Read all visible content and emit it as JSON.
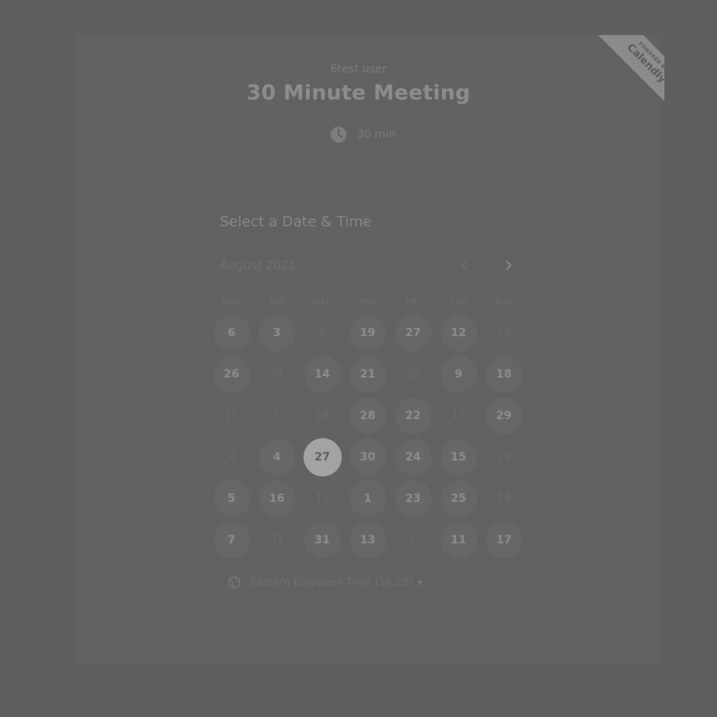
{
  "event": {
    "owner": "6test user",
    "title": "30 Minute Meeting",
    "duration": "30 min"
  },
  "badge": {
    "powered_by": "POWERED BY",
    "brand": "Calendly"
  },
  "calendar": {
    "section_title": "Select a Date & Time",
    "month": "August 2021",
    "weekdays": [
      "MON",
      "TUE",
      "WED",
      "THU",
      "FRI",
      "SAT",
      "SUN"
    ],
    "days": [
      {
        "label": "6",
        "available": true
      },
      {
        "label": "3",
        "available": true
      },
      {
        "label": "8",
        "available": false
      },
      {
        "label": "19",
        "available": true
      },
      {
        "label": "27",
        "available": true
      },
      {
        "label": "12",
        "available": true
      },
      {
        "label": "19",
        "available": false
      },
      {
        "label": "26",
        "available": true
      },
      {
        "label": "24",
        "available": false
      },
      {
        "label": "14",
        "available": true
      },
      {
        "label": "21",
        "available": true
      },
      {
        "label": "22",
        "available": false
      },
      {
        "label": "9",
        "available": true
      },
      {
        "label": "18",
        "available": true
      },
      {
        "label": "15",
        "available": false
      },
      {
        "label": "1",
        "available": false
      },
      {
        "label": "18",
        "available": false
      },
      {
        "label": "28",
        "available": true
      },
      {
        "label": "22",
        "available": true
      },
      {
        "label": "13",
        "available": false
      },
      {
        "label": "29",
        "available": true
      },
      {
        "label": "8",
        "available": false
      },
      {
        "label": "4",
        "available": true
      },
      {
        "label": "27",
        "available": true,
        "selected": true
      },
      {
        "label": "30",
        "available": true
      },
      {
        "label": "24",
        "available": true
      },
      {
        "label": "15",
        "available": true
      },
      {
        "label": "29",
        "available": false
      },
      {
        "label": "5",
        "available": true
      },
      {
        "label": "16",
        "available": true
      },
      {
        "label": "10",
        "available": false
      },
      {
        "label": "1",
        "available": true
      },
      {
        "label": "23",
        "available": true
      },
      {
        "label": "25",
        "available": true
      },
      {
        "label": "14",
        "available": false
      },
      {
        "label": "7",
        "available": true
      },
      {
        "label": "21",
        "available": false
      },
      {
        "label": "31",
        "available": true
      },
      {
        "label": "13",
        "available": true
      },
      {
        "label": "1",
        "available": false
      },
      {
        "label": "11",
        "available": true
      },
      {
        "label": "17",
        "available": true
      }
    ]
  },
  "timezone": {
    "label": "Eastern European Time (16:28)"
  },
  "icons": {
    "duration": "clock-icon",
    "timezone": "globe-icon",
    "prev": "chevron-left-icon",
    "next": "chevron-right-icon",
    "dropdown": "caret-down-icon"
  },
  "colors": {
    "overlay_background": "#5f5f5f",
    "selected_day": "#a3a3a3",
    "available_day": "#676767",
    "badge": "#8b8b8b"
  }
}
